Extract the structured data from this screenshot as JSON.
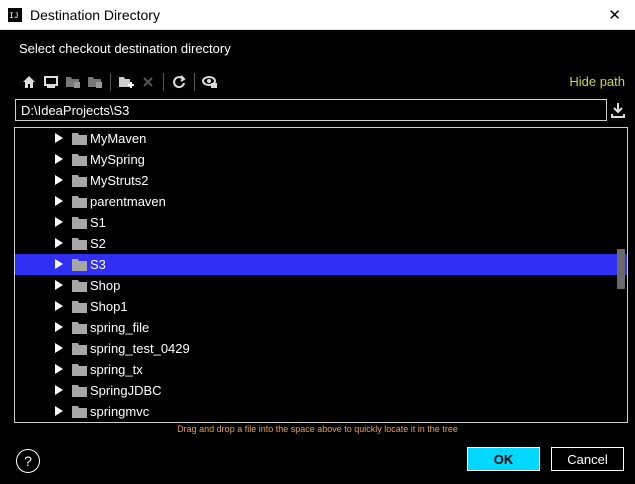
{
  "window": {
    "title": "Destination Directory",
    "app_icon_text": "IJ"
  },
  "prompt": "Select checkout destination directory",
  "toolbar": {
    "buttons": [
      "home-icon",
      "desktop-icon",
      "project-folder-icon",
      "module-folder-icon",
      "new-folder-icon",
      "delete-icon",
      "refresh-icon",
      "show-hidden-icon"
    ],
    "hide_path_label": "Hide path",
    "hide_path_color": "#c9d832"
  },
  "path": {
    "value": "D:\\IdeaProjects\\S3"
  },
  "tree": {
    "items": [
      {
        "label": "MyMaven"
      },
      {
        "label": "MySpring"
      },
      {
        "label": "MyStruts2"
      },
      {
        "label": "parentmaven"
      },
      {
        "label": "S1"
      },
      {
        "label": "S2"
      },
      {
        "label": "S3",
        "selected": true
      },
      {
        "label": "Shop"
      },
      {
        "label": "Shop1"
      },
      {
        "label": "spring_file"
      },
      {
        "label": "spring_test_0429"
      },
      {
        "label": "spring_tx"
      },
      {
        "label": "SpringJDBC"
      },
      {
        "label": "springmvc"
      }
    ],
    "selection_color": "#2f2ff5"
  },
  "hint": "Drag and drop a file into the space above to quickly locate it in the tree",
  "buttons": {
    "help": "?",
    "ok": "OK",
    "cancel": "Cancel"
  },
  "colors": {
    "accent": "#00d8ff",
    "hint": "#e8a23a"
  }
}
